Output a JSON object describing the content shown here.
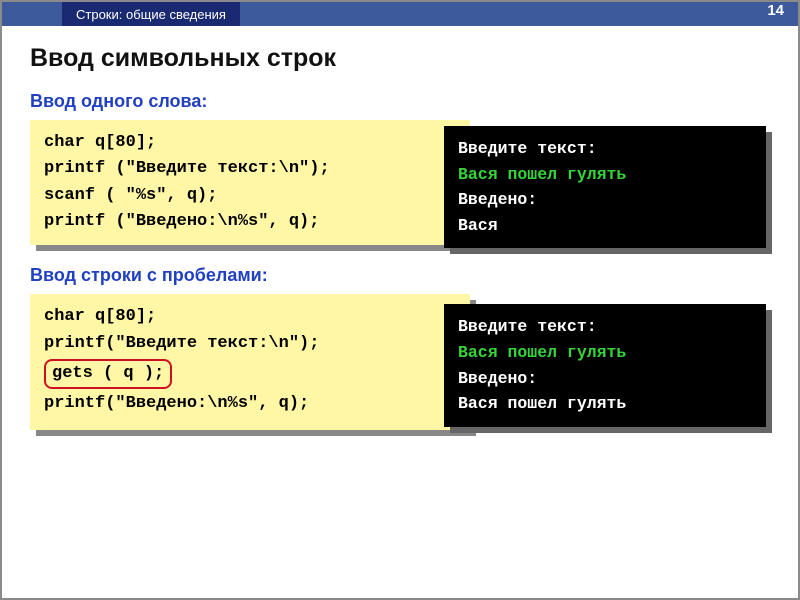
{
  "topbar": {
    "tab": "Строки: общие сведения",
    "page_number": "14"
  },
  "title": "Ввод символьных строк",
  "section1": {
    "label": "Ввод одного слова:",
    "code_line1": "char q[80];",
    "code_line2": "printf (\"Введите текст:\\n\");",
    "code_line3": "scanf ( \"%s\", q);",
    "code_line4": "printf (\"Введено:\\n%s\", q);",
    "console": {
      "prompt": "Введите текст:",
      "input": "Вася пошел гулять",
      "label": "Введено:",
      "output": "Вася"
    }
  },
  "section2": {
    "label": "Ввод строки с пробелами:",
    "code_line1": "char q[80];",
    "code_line2": "printf(\"Введите текст:\\n\");",
    "code_gets": "gets ( q );",
    "code_line4": "printf(\"Введено:\\n%s\", q);",
    "console": {
      "prompt": "Введите текст:",
      "input": "Вася пошел гулять",
      "label": "Введено:",
      "output": "Вася пошел гулять"
    }
  }
}
